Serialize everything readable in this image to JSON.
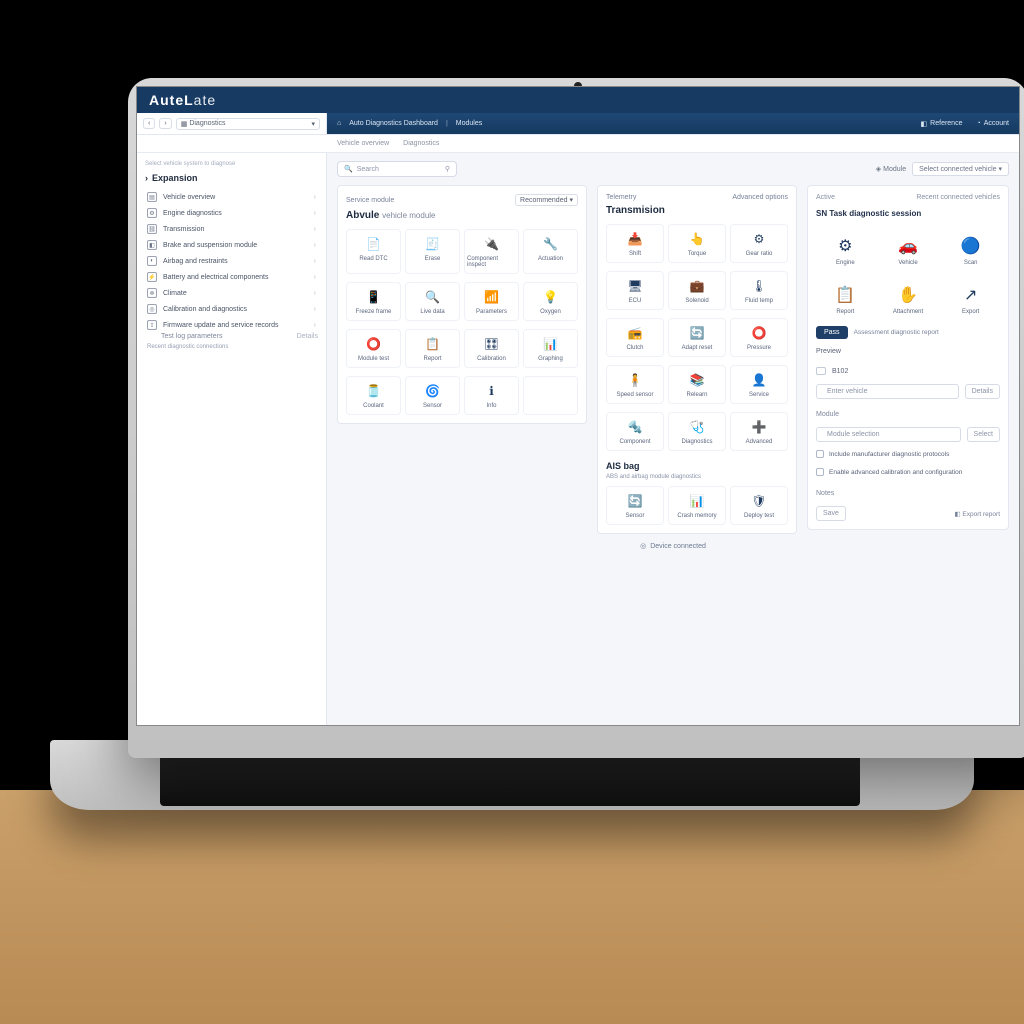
{
  "brand": {
    "name": "AuteL",
    "suffix": "ate"
  },
  "topnav": {
    "dropdown": "Diagnostics",
    "breadcrumb1": "Auto Diagnostics Dashboard",
    "breadcrumb2": "Modules",
    "link_reference": "Reference",
    "link_account": "Account"
  },
  "subnav": {
    "item1": "Vehicle overview",
    "item2": "Diagnostics"
  },
  "sidebar": {
    "note_top": "Select vehicle system to diagnose",
    "header": "Expansion",
    "items": [
      {
        "label": "Vehicle overview",
        "icon": "▤"
      },
      {
        "label": "Engine diagnostics",
        "icon": "⚙"
      },
      {
        "label": "Transmission",
        "icon": "⛓"
      },
      {
        "label": "Brake and suspension module",
        "icon": "◧"
      },
      {
        "label": "Airbag and restraints",
        "icon": "◐"
      },
      {
        "label": "Battery and electrical components",
        "icon": "⚡"
      },
      {
        "label": "Climate",
        "icon": "❄"
      },
      {
        "label": "Calibration and diagnostics",
        "icon": "◎"
      },
      {
        "label": "Firmware update and service records",
        "icon": "⇪"
      }
    ],
    "sub1": {
      "label": "Test log parameters",
      "tag": "Details"
    },
    "note_bottom": "Recent diagnostic connections"
  },
  "toolbar": {
    "search_placeholder": "Search",
    "btn_filter": "Filter",
    "right_label": "Module",
    "right_dropdown": "Select connected vehicle"
  },
  "panel_module": {
    "topleft": "Service module",
    "topright_btn": "Recommended",
    "title": "Abvule",
    "subtitle": "vehicle module",
    "tiles": [
      {
        "label": "Read DTC",
        "glyph": "📄"
      },
      {
        "label": "Erase",
        "glyph": "🧾"
      },
      {
        "label": "Component inspect",
        "glyph": "🔌"
      },
      {
        "label": "Actuation",
        "glyph": "🔧"
      },
      {
        "label": "Freeze frame",
        "glyph": "📱"
      },
      {
        "label": "Live data",
        "glyph": "🔍"
      },
      {
        "label": "Parameters",
        "glyph": "📶"
      },
      {
        "label": "Oxygen",
        "glyph": "💡"
      },
      {
        "label": "Module test",
        "glyph": "⭕"
      },
      {
        "label": "Report",
        "glyph": "📋"
      },
      {
        "label": "Calibration",
        "glyph": "🎛"
      },
      {
        "label": "Graphing",
        "glyph": "📊"
      },
      {
        "label": "Coolant",
        "glyph": "🫙"
      },
      {
        "label": "Sensor",
        "glyph": "🌀"
      },
      {
        "label": "Info",
        "glyph": "ℹ"
      },
      {
        "label": "",
        "glyph": ""
      }
    ]
  },
  "panel_trans": {
    "topleft": "Telemetry",
    "topright": "Advanced options",
    "title": "Transmision",
    "tiles": [
      {
        "label": "Shift",
        "glyph": "📥"
      },
      {
        "label": "Torque",
        "glyph": "👆"
      },
      {
        "label": "Gear ratio",
        "glyph": "⚙"
      },
      {
        "label": "ECU",
        "glyph": "🖥"
      },
      {
        "label": "Solenoid",
        "glyph": "💼"
      },
      {
        "label": "Fluid temp",
        "glyph": "🌡"
      },
      {
        "label": "Clutch",
        "glyph": "📻"
      },
      {
        "label": "Adapt reset",
        "glyph": "🔄"
      },
      {
        "label": "Pressure",
        "glyph": "⭕"
      },
      {
        "label": "Speed sensor",
        "glyph": "🧍"
      },
      {
        "label": "Relearn",
        "glyph": "📚"
      },
      {
        "label": "Service",
        "glyph": "👤"
      },
      {
        "label": "Component",
        "glyph": "🔩"
      },
      {
        "label": "Diagnostics",
        "glyph": "🩺"
      },
      {
        "label": "Advanced",
        "glyph": "➕"
      }
    ],
    "airbag_title": "AIS bag",
    "airbag_desc": "ABS and airbag module diagnostics",
    "airbag_tiles": [
      {
        "label": "Sensor",
        "glyph": "🔄"
      },
      {
        "label": "Crash memory",
        "glyph": "📊"
      },
      {
        "label": "Deploy test",
        "glyph": "🛡"
      }
    ]
  },
  "panel_right": {
    "hdr_left": "Active",
    "hdr_right": "Recent connected vehicles",
    "section_title": "SN Task diagnostic session",
    "top_tiles": [
      {
        "label": "Engine",
        "glyph": "⚙"
      },
      {
        "label": "Vehicle",
        "glyph": "🚗"
      },
      {
        "label": "Scan",
        "glyph": "🔵"
      },
      {
        "label": "Report",
        "glyph": "📋"
      },
      {
        "label": "Attachment",
        "glyph": "✋"
      },
      {
        "label": "Export",
        "glyph": "↗"
      }
    ],
    "btn_primary": "Pass",
    "btn_secondary_text": "Assessment diagnostic report",
    "field_preview": "Preview",
    "field_code": "B102",
    "row_input1": "Enter vehicle",
    "row_btn1": "Details",
    "small_title1": "Module",
    "row_input2": "Module selection",
    "row_tag": "Select",
    "chk1": "Include manufacturer diagnostic protocols",
    "chk2": "Enable advanced calibration and configuration",
    "small_title2": "Notes",
    "footer_btn1": "Save",
    "footer_btn2": "Export report"
  },
  "footer": {
    "device": "Device connected"
  }
}
